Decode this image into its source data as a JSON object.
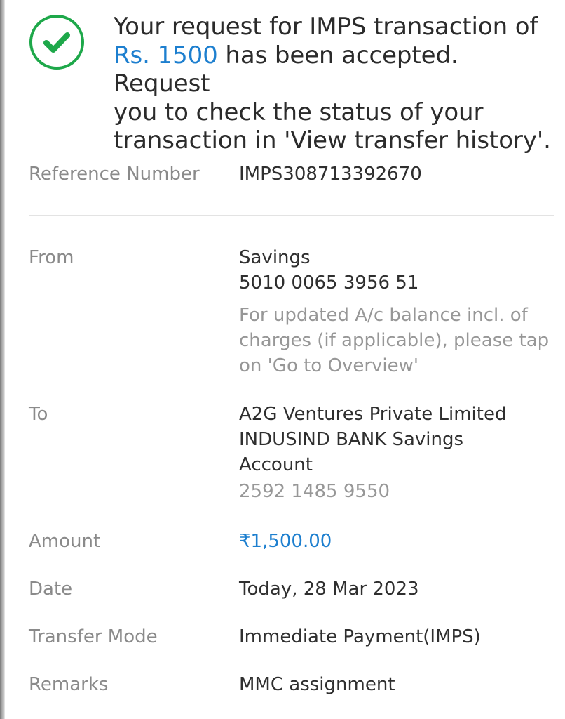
{
  "confirmation": {
    "line1": "Your request for IMPS transaction of",
    "amount": "Rs. 1500",
    "line2_rest": " has been accepted. Request",
    "line3": "you to check the status of your",
    "line4": "transaction in 'View transfer history'."
  },
  "reference": {
    "label": "Reference Number",
    "value": "IMPS308713392670"
  },
  "from": {
    "label": "From",
    "account_type": "Savings",
    "account_number": "5010 0065 3956 51",
    "note_line1": "For updated A/c balance incl. of",
    "note_line2": "charges (if applicable), please tap",
    "note_line3": "on 'Go to Overview'"
  },
  "to": {
    "label": "To",
    "name": "A2G Ventures Private Limited",
    "bank_line1": "INDUSIND BANK Savings",
    "bank_line2": "Account",
    "account_number": "2592 1485 9550"
  },
  "amount": {
    "label": "Amount",
    "value": "₹1,500.00"
  },
  "date": {
    "label": "Date",
    "value": "Today, 28 Mar 2023"
  },
  "transfer_mode": {
    "label": "Transfer Mode",
    "value": "Immediate Payment(IMPS)"
  },
  "remarks": {
    "label": "Remarks",
    "value": "MMC assignment"
  },
  "colors": {
    "success_green": "#1ea84a",
    "accent_blue": "#1d7fcf"
  },
  "icons": {
    "status": "check-circle-icon"
  }
}
